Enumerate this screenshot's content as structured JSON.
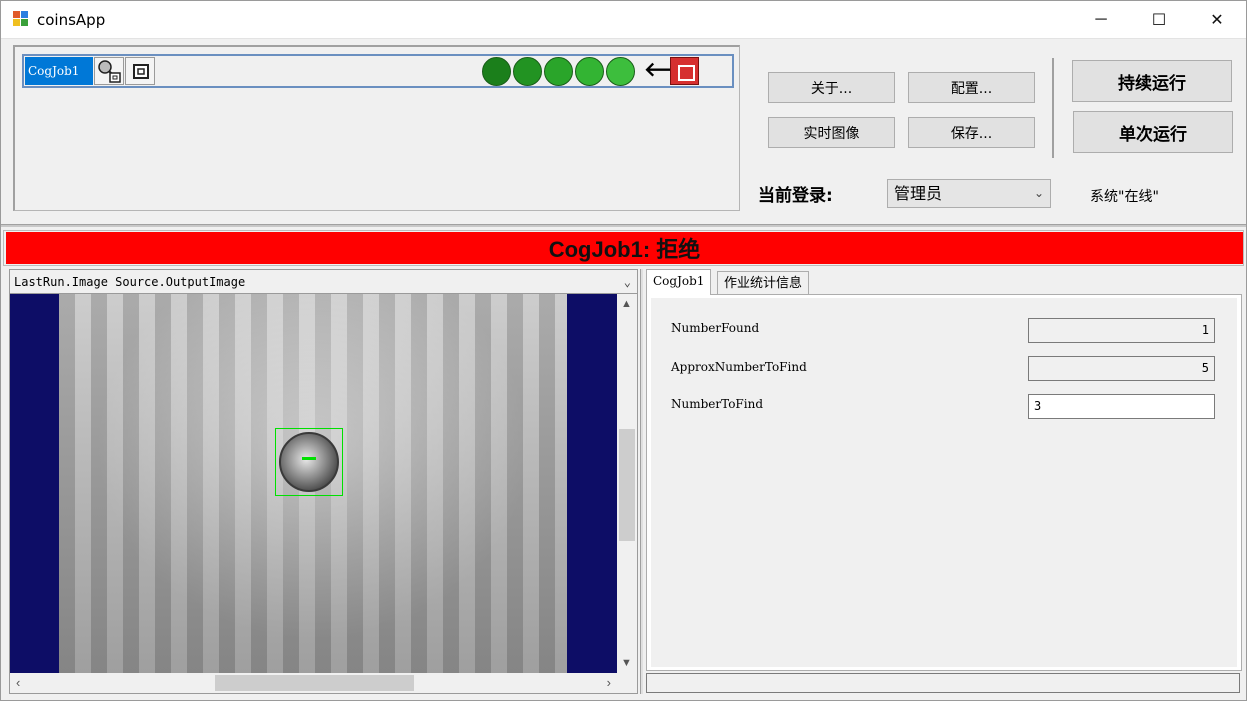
{
  "window": {
    "title": "coinsApp",
    "controls": {
      "minimize": "─",
      "maximize": "☐",
      "close": "✕"
    }
  },
  "toolblock": {
    "job_label": "CogJob1",
    "circle_colors": [
      "#1b7f1b",
      "#229322",
      "#2aa52a",
      "#33b433",
      "#3dbe3d"
    ],
    "icons": [
      "tool-group-icon",
      "tool-frame-icon",
      "arrow-left-icon",
      "stop-icon"
    ],
    "arrow": "🡐"
  },
  "buttons": {
    "about": "关于...",
    "config": "配置...",
    "live_image": "实时图像",
    "save": "保存...",
    "run_continuous": "持续运行",
    "run_once": "单次运行"
  },
  "login": {
    "label": "当前登录:",
    "selected_user": "管理员",
    "status": "系统\"在线\""
  },
  "result_banner": {
    "text": "CogJob1: 拒绝",
    "color": "#ff0000"
  },
  "image_display": {
    "source": "LastRun.Image Source.OutputImage"
  },
  "tabs": [
    {
      "label": "CogJob1",
      "active": true
    },
    {
      "label": "作业统计信息",
      "active": false
    }
  ],
  "properties": [
    {
      "label": "NumberFound",
      "value": "1",
      "editable": false
    },
    {
      "label": "ApproxNumberToFind",
      "value": "5",
      "editable": false
    },
    {
      "label": "NumberToFind",
      "value": "3",
      "editable": true
    }
  ]
}
